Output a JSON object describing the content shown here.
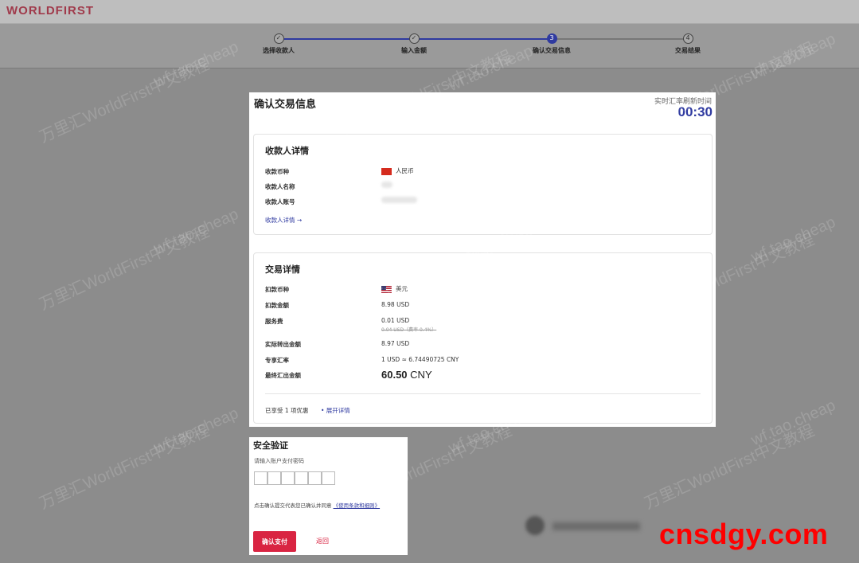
{
  "app": {
    "logo": "WORLDFIRST"
  },
  "stepper": {
    "steps": [
      {
        "label": "选择收款人",
        "status": "done",
        "mark": "✓"
      },
      {
        "label": "输入金额",
        "status": "done",
        "mark": "✓"
      },
      {
        "label": "确认交易信息",
        "status": "active",
        "mark": "3"
      },
      {
        "label": "交易结果",
        "status": "pending",
        "mark": "4"
      }
    ]
  },
  "confirm": {
    "title": "确认交易信息",
    "timer_label": "实时汇率刷新时间",
    "timer": "00:30"
  },
  "payee": {
    "title": "收款人详情",
    "currency_label": "收款币种",
    "currency_value": "人民币",
    "name_label": "收款人名称",
    "account_label": "收款人账号",
    "details_link": "收款人详情 →"
  },
  "transaction": {
    "title": "交易详情",
    "debit_currency_label": "扣款币种",
    "debit_currency_value": "美元",
    "debit_amount_label": "扣款金额",
    "debit_amount_value": "8.98 USD",
    "fee_label": "服务费",
    "fee_value": "0.01 USD",
    "fee_original": "0.04 USD（费率 0.4%）",
    "actual_label": "实际转出金额",
    "actual_value": "8.97 USD",
    "rate_label": "专享汇率",
    "rate_value": "1 USD ≈ 6.74490725 CNY",
    "final_label": "最终汇出金额",
    "final_amount": "60.50",
    "final_currency": "CNY",
    "discount_text": "已享受 1 项优惠",
    "expand_link": "• 展开详情"
  },
  "security": {
    "title": "安全验证",
    "hint": "请输入账户支付密码",
    "agree_text": "点击确认提交代表您已确认并同意",
    "terms_link": "《使用条款和细则》",
    "confirm_button": "确认支付",
    "back_link": "返回"
  },
  "watermarks": {
    "text_cn": "万里汇WorldFirst中文教程",
    "text_url": "wf.tao.cheap",
    "brand": "cnsdgy.com"
  },
  "colors": {
    "brand_red": "#c8102e",
    "accent_blue": "#2f3aa0",
    "button_red": "#d92442"
  }
}
